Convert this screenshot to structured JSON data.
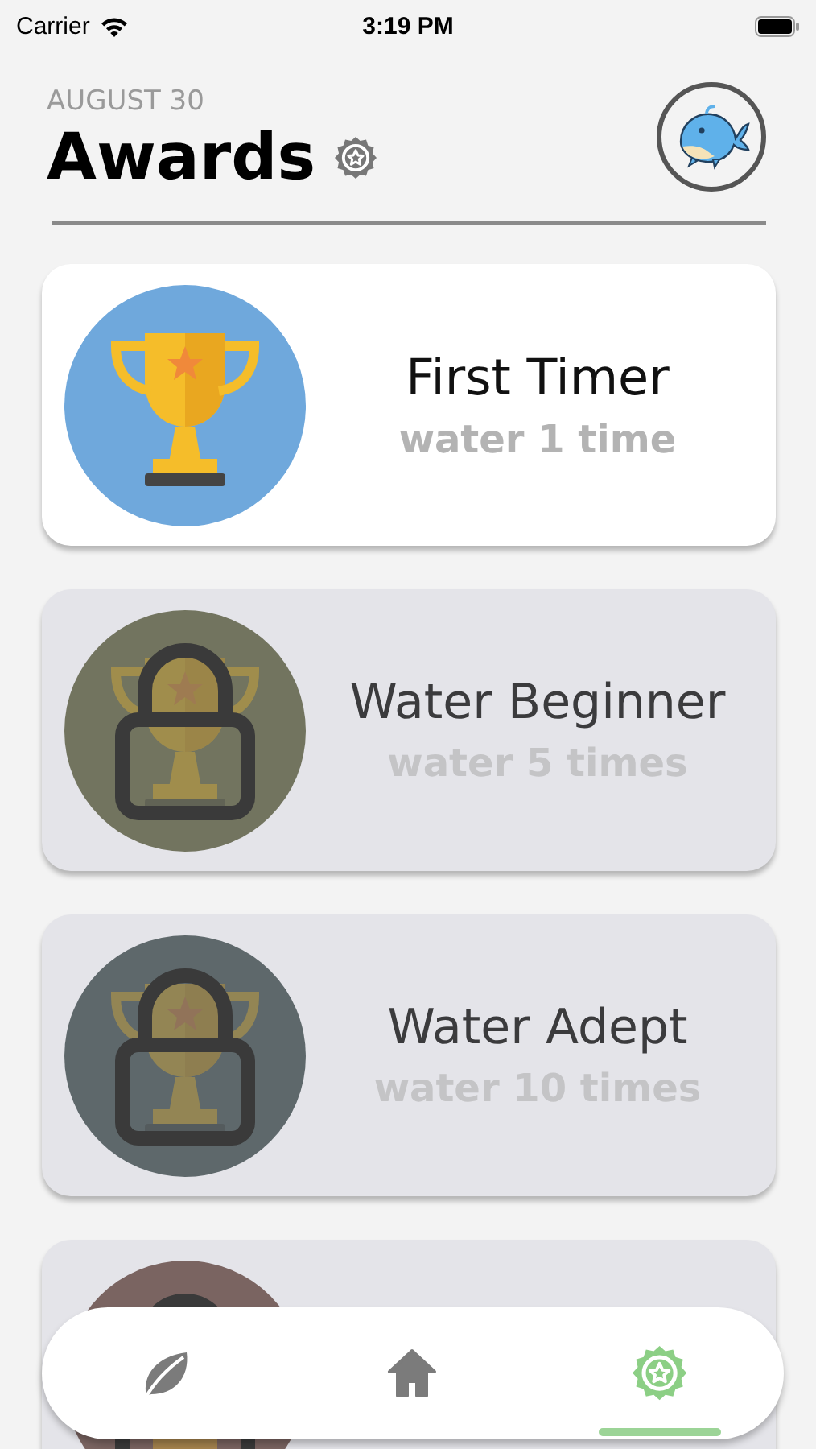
{
  "status_bar": {
    "carrier": "Carrier",
    "time": "3:19 PM"
  },
  "header": {
    "date": "AUGUST 30",
    "title": "Awards"
  },
  "awards": [
    {
      "title": "First Timer",
      "subtitle": "water 1 time",
      "locked": false,
      "color": "#6fa8dc"
    },
    {
      "title": "Water Beginner",
      "subtitle": "water 5 times",
      "locked": true,
      "color": "#72745f"
    },
    {
      "title": "Water Adept",
      "subtitle": "water 10 times",
      "locked": true,
      "color": "#5e686b"
    },
    {
      "locked": true,
      "color": "#7a6461"
    }
  ],
  "tabs": [
    {
      "kind": "leaf",
      "selected": false
    },
    {
      "kind": "home",
      "selected": false
    },
    {
      "kind": "badge",
      "selected": true
    }
  ]
}
